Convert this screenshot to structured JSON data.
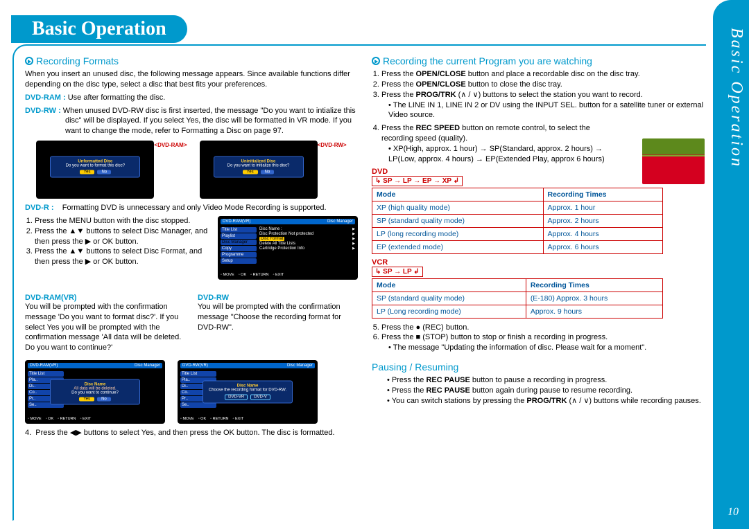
{
  "page": {
    "title_pill": "Basic Operation",
    "side_tab": "Basic Operation",
    "number": "10"
  },
  "left": {
    "hdr": "Recording Formats",
    "intro": "When you insert an unused disc, the following message appears. Since available functions differ depending on the disc type, select a disc that best fits your preferences.",
    "ram_lbl": "DVD-RAM :",
    "ram_txt": "Use after   formatting the disc.",
    "rw_lbl": "DVD-RW :",
    "rw_txt": "When unused DVD-RW disc is first inserted, the message \"Do you want to intialize this disc\" will be displayed. If you select Yes, the disc will be formatted in VR mode. If you want to change the mode, refer to Formatting a Disc on page 97.",
    "scr1": {
      "title": "Unformatted Disc",
      "line": "Do you want to format this disc?",
      "yes": "Yes",
      "no": "No",
      "label": "<DVD-RAM>"
    },
    "scr2": {
      "title": "Uninitialized Disc",
      "line": "Do you want to initialize this disc?",
      "yes": "Yes",
      "no": "No",
      "label": "<DVD-RW>"
    },
    "dvdr_lbl": "DVD-R :",
    "dvdr_txt": "Formatting DVD is unnecessary and only Video Mode Recording is supported.",
    "steps": [
      "Press the MENU button with the disc stopped.",
      "Press the  ▲▼ buttons to select Disc Manager, and then press the  ▶  or OK button.",
      "Press the  ▲▼ buttons to select Disc Format, and then press the  ▶   or OK button."
    ],
    "scr_dm": {
      "hdr_left": "DVD-RAM(VR)",
      "hdr_right": "Disc Manager",
      "menu": [
        "Title List",
        "Playlist",
        "Disc Manager",
        "Copy",
        "Programme",
        "Setup"
      ],
      "rows": [
        "Disc Name",
        ":",
        "Disc Protection",
        "Not protected",
        "Disc Format",
        "",
        "Delete All Title Lists",
        "",
        "Cartridge Protection Info",
        ""
      ],
      "foot": [
        "MOVE",
        "OK",
        "RETURN",
        "EXIT"
      ]
    },
    "ramvr_lbl": "DVD-RAM(VR)",
    "ramvr_txt": "You will be prompted with the confirmation message 'Do you want to format disc?'. If you select Yes you will be prompted with the confirmation message 'All data will be deleted. Do you want to continue?'",
    "rw2_lbl": "DVD-RW",
    "rw2_txt": "You will be prompted with the confirmation message \"Choose the recording format for DVD-RW\".",
    "scr3": {
      "hdr_left": "DVD-RAM(VR)",
      "hdr_right": "Disc Manager",
      "dlg_title": "Disc Name",
      "dlg_line": "All data will be deleted.",
      "dlg_line2": "Do you want to continue?",
      "yes": "Yes",
      "no": "No"
    },
    "scr4": {
      "hdr_left": "DVD-RW(VR)",
      "hdr_right": "Disc Manager",
      "dlg_title": "Disc Name",
      "dlg_line": "Choose the recording format for DVD-RW.",
      "btn1": "DVD-VR",
      "btn2": "DVD-V"
    },
    "step4": "Press the  ◀▶ buttons to select Yes, and then press the OK button. The disc is formatted."
  },
  "right": {
    "hdr": "Recording the current Program you are watching",
    "s1": "Press the OPEN/CLOSE button and place a recordable disc on the disc tray.",
    "s2": "Press the OPEN/CLOSE button to close the disc tray.",
    "s3": "Press the PROG/TRK (∧ / ∨) buttons to select the station you want to record.",
    "s3b": "The LINE IN 1, LINE IN 2 or DV using the INPUT SEL. button for a satellite tuner or external Video source.",
    "s4": "Press the REC SPEED button on remote control, to select the recording speed (quality).",
    "s4b": "XP(High, approx. 1 hour) → SP(Standard, approx. 2 hours) → LP(Low, approx. 4 hours) → EP(Extended Play, approx 6 hours)",
    "dvd_lbl": "DVD",
    "dvd_seq": "↳ SP → LP → EP → XP ↲",
    "tbl1": {
      "h1": "Mode",
      "h2": "Recording Times",
      "r": [
        [
          "XP (high quality mode)",
          "Approx. 1 hour"
        ],
        [
          "SP (standard quality mode)",
          "Approx. 2 hours"
        ],
        [
          "LP (long recording mode)",
          "Approx. 4 hours"
        ],
        [
          "EP (extended mode)",
          "Approx. 6 hours"
        ]
      ]
    },
    "vcr_lbl": "VCR",
    "vcr_seq": "↳ SP → LP ↲",
    "tbl2": {
      "h1": "Mode",
      "h2": "Recording Times",
      "r": [
        [
          "SP (standard quality mode)",
          "(E-180) Approx. 3 hours"
        ],
        [
          "LP (Long recording mode)",
          "Approx. 9 hours"
        ]
      ]
    },
    "s5": "Press the ● (REC) button.",
    "s6": "Press the  ■ (STOP) button to stop or finish a recording in progress.",
    "s6b": "The message \"Updating the information of disc. Please wait for a moment\".",
    "pause_hdr": "Pausing / Resuming",
    "p1": "Press the REC PAUSE button to pause a recording in progress.",
    "p2": "Press the REC PAUSE button again during pause to resume recording.",
    "p3": "You can switch stations by pressing the PROG/TRK (∧ / ∨)  buttons while recording pauses."
  }
}
